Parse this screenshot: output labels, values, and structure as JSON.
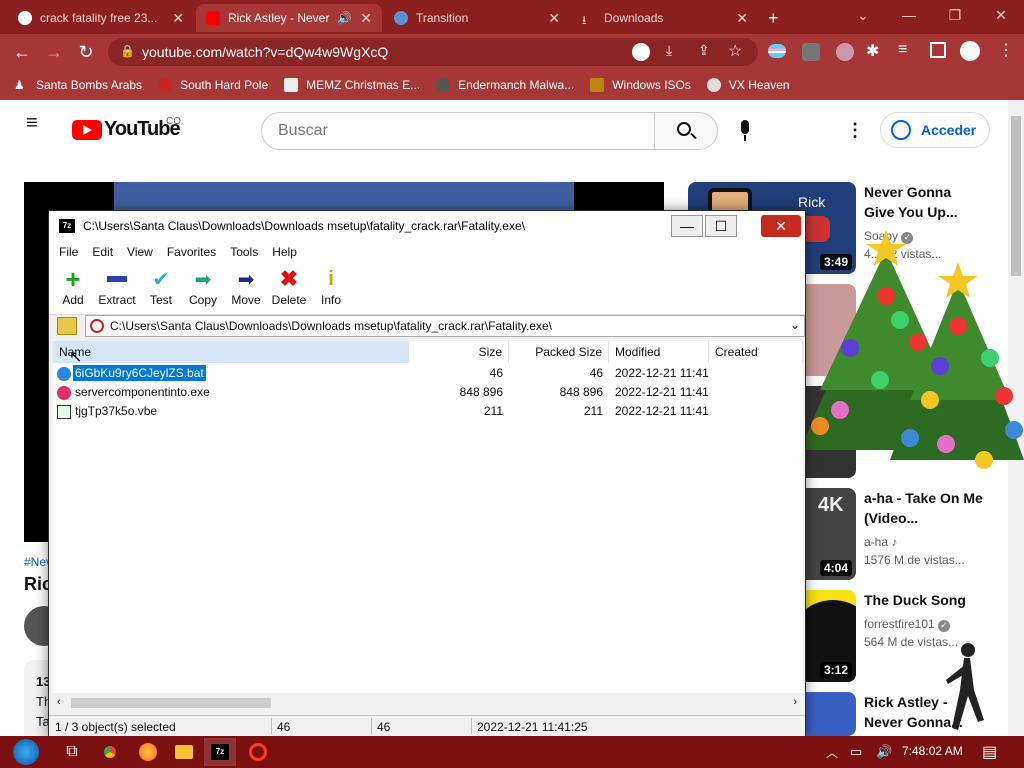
{
  "browser": {
    "tabs": [
      {
        "title": "crack fatality free 23..."
      },
      {
        "title": "Rick Astley - Never"
      },
      {
        "title": "Transition"
      },
      {
        "title": "Downloads"
      }
    ],
    "url": "youtube.com/watch?v=dQw4w9WgXcQ",
    "bookmarks": [
      "Santa Bombs Arabs",
      "South Hard Pole",
      "MEMZ Christmas E...",
      "Endermanch Malwa...",
      "Windows ISOs",
      "VX Heaven"
    ]
  },
  "youtube": {
    "logo": "YouTube",
    "country": "CO",
    "search_placeholder": "Buscar",
    "signin": "Acceder",
    "hashtag": "#Nev",
    "video_title": "Ric",
    "views_fragment": "13",
    "desc_1": "Th",
    "desc_2": "Ta",
    "suggestions": [
      {
        "title": "Never Gonna Give You Up...",
        "channel": "Soapy",
        "meta": "4... 22 vistas...",
        "duration": "3:49",
        "thumb_text": "Rick"
      },
      {
        "title": "...ley -",
        "channel": "",
        "meta": "",
        "duration": ""
      },
      {
        "title": "a-ha - Take On Me (Video...",
        "channel": "a-ha",
        "meta": "1576 M de vistas...",
        "duration": "4:04",
        "thumb_text": "4K"
      },
      {
        "title": "The Duck Song",
        "channel": "forrestfire101",
        "meta": "564 M de vistas...",
        "duration": "3:12"
      },
      {
        "title": "Rick Astley - Never Gonna...",
        "channel": "",
        "meta": "",
        "duration": ""
      }
    ]
  },
  "sevenzip": {
    "title": "C:\\Users\\Santa Claus\\Downloads\\Downloads msetup\\fatality_crack.rar\\Fatality.exe\\",
    "menu": [
      "File",
      "Edit",
      "View",
      "Favorites",
      "Tools",
      "Help"
    ],
    "toolbar": [
      "Add",
      "Extract",
      "Test",
      "Copy",
      "Move",
      "Delete",
      "Info"
    ],
    "path": "C:\\Users\\Santa Claus\\Downloads\\Downloads msetup\\fatality_crack.rar\\Fatality.exe\\",
    "columns": [
      "Name",
      "Size",
      "Packed Size",
      "Modified",
      "Created"
    ],
    "files": [
      {
        "name": "6iGbKu9ry6CJeylZS.bat",
        "size": "46",
        "packed": "46",
        "modified": "2022-12-21 11:41",
        "selected": true
      },
      {
        "name": "servercomponentinto.exe",
        "size": "848 896",
        "packed": "848 896",
        "modified": "2022-12-21 11:41",
        "selected": false
      },
      {
        "name": "tjgTp37k5o.vbe",
        "size": "211",
        "packed": "211",
        "modified": "2022-12-21 11:41",
        "selected": false
      }
    ],
    "status": {
      "selection": "1 / 3 object(s) selected",
      "size": "46",
      "packed": "46",
      "modified": "2022-12-21 11:41:25"
    }
  },
  "taskbar": {
    "time": "7:48:02 AM"
  },
  "colors": {
    "chrome_dark": "#8c1f1f",
    "chrome": "#a73737",
    "taskbar": "#7b1010",
    "yt_red": "#ff0000",
    "close_red": "#c42b1c"
  }
}
